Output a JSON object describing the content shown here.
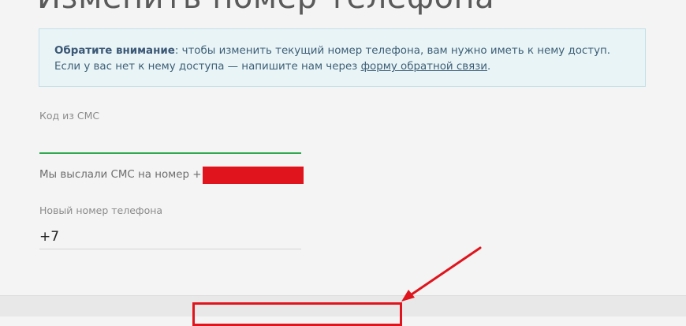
{
  "page": {
    "title": "Изменить номер телефона"
  },
  "notice": {
    "bold_label": "Обратите внимание",
    "line1_rest": ": чтобы изменить текущий номер телефона, вам нужно иметь к нему доступ.",
    "line2_prefix": "Если у вас нет к нему доступа — напишите нам через ",
    "link_text": "форму обратной связи",
    "line2_suffix": "."
  },
  "sms_code": {
    "label": "Код из СМС",
    "value": ""
  },
  "sent_message": {
    "text": "Мы выслали СМС на номер +"
  },
  "new_phone": {
    "label": "Новый номер телефона",
    "value": "+7"
  },
  "colors": {
    "accent_green": "#2fa84f",
    "annotation_red": "#e0141c",
    "notice_background": "#e9f4f7"
  }
}
